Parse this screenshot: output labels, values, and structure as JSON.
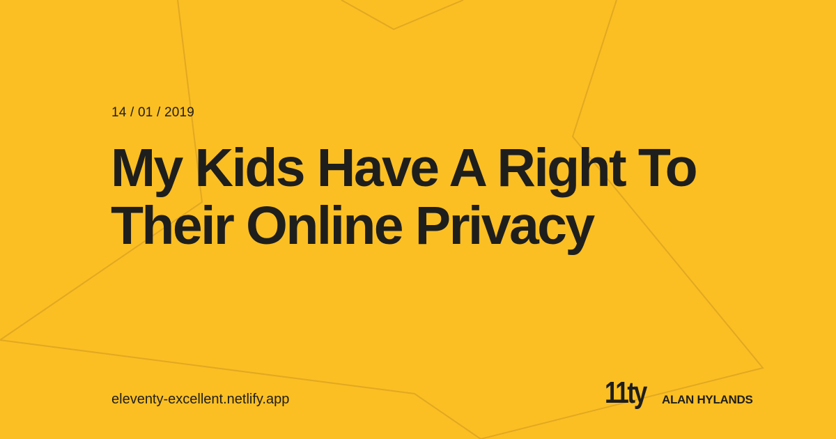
{
  "colors": {
    "background": "#fbbf24",
    "star_outline": "#e2a820",
    "text": "#1e1e1c"
  },
  "post": {
    "date": "14 / 01 / 2019",
    "title_line_1": "My Kids Have A Right To",
    "title_line_2": "Their Online Privacy"
  },
  "footer": {
    "site_url": "eleventy-excellent.netlify.app",
    "logo_text": "11ty",
    "author": "ALAN HYLANDS"
  },
  "icons": {
    "logo": "eleventy-logo-icon",
    "background": "star-outline-decoration"
  }
}
